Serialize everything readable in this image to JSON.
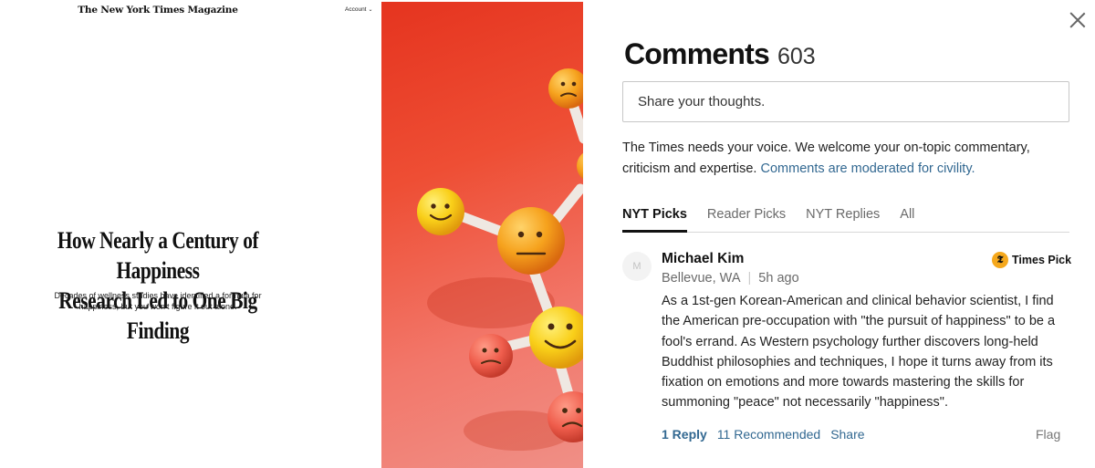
{
  "article": {
    "masthead": "The New York Times Magazine",
    "account_label": "Account",
    "headline_line1": "How Nearly a Century of Happiness",
    "headline_line2": "Research Led to One Big Finding",
    "dek": "Decades of wellness studies have identified a formula for happiness, but you won’t figure it out alone."
  },
  "hero_image": {
    "background_colors": [
      "#e5341f",
      "#f08f86"
    ],
    "ball_color": "#f6a21d",
    "stick_color": "#e8e2dc"
  },
  "comments": {
    "title": "Comments",
    "count": "603",
    "input_placeholder": "Share your thoughts.",
    "intro_text": "The Times needs your voice. We welcome your on-topic commentary, criticism and expertise.",
    "intro_link": "Comments are moderated for civility.",
    "tabs": [
      {
        "label": "NYT Picks",
        "active": true
      },
      {
        "label": "Reader Picks",
        "active": false
      },
      {
        "label": "NYT Replies",
        "active": false
      },
      {
        "label": "All",
        "active": false
      }
    ],
    "items": [
      {
        "avatar_initial": "M",
        "author": "Michael Kim",
        "location": "Bellevue, WA",
        "time": "5h ago",
        "badge_label": "Times Pick",
        "body": "As a 1st-gen Korean-American and clinical behavior scientist, I find the American pre-occupation with \"the pursuit of happiness\" to be a fool's errand. As Western psychology further discovers long-held Buddhist philosophies and techniques, I hope it turns away from its fixation on emotions and more towards mastering the skills for summoning \"peace\" not necessarily \"happiness\".",
        "reply_label": "1 Reply",
        "recommend_label": "11 Recommended",
        "share_label": "Share",
        "flag_label": "Flag"
      }
    ],
    "link_color": "#326891"
  }
}
